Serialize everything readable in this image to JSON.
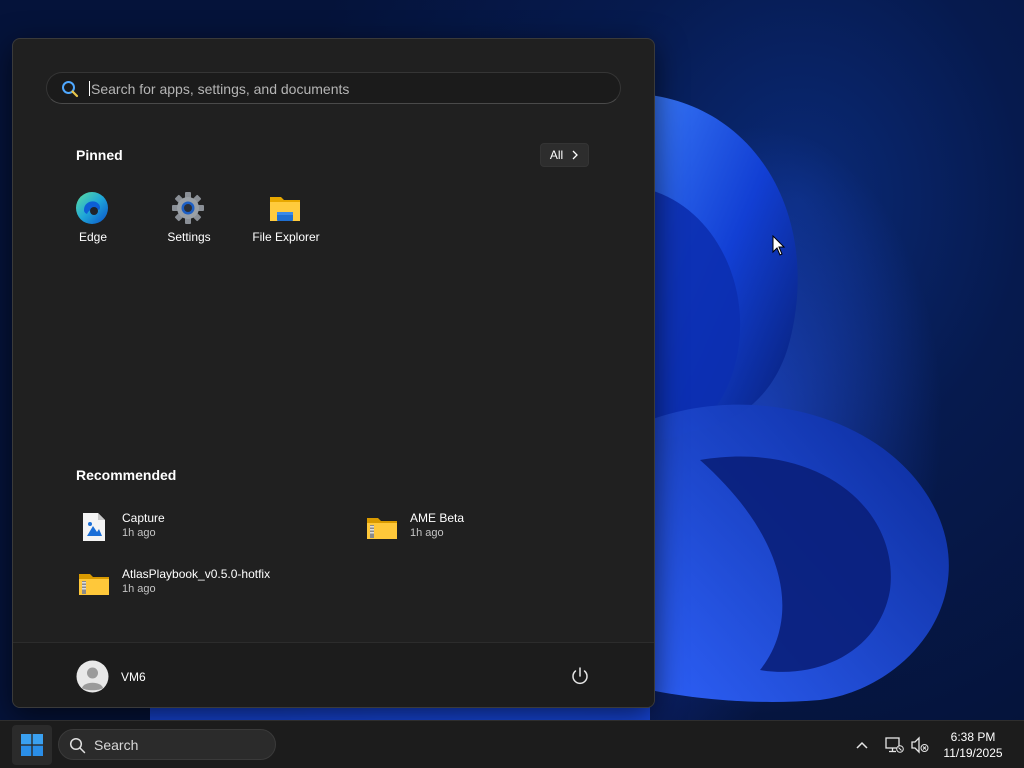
{
  "start_menu": {
    "search": {
      "placeholder": "Search for apps, settings, and documents"
    },
    "pinned": {
      "title": "Pinned",
      "all_label": "All",
      "apps": [
        {
          "label": "Edge",
          "icon": "edge-icon"
        },
        {
          "label": "Settings",
          "icon": "gear-icon"
        },
        {
          "label": "File Explorer",
          "icon": "folder-icon"
        }
      ]
    },
    "recommended": {
      "title": "Recommended",
      "items": [
        {
          "name": "Capture",
          "time": "1h ago",
          "icon": "image-file-icon"
        },
        {
          "name": "AME Beta",
          "time": "1h ago",
          "icon": "zip-folder-icon"
        },
        {
          "name": "AtlasPlaybook_v0.5.0-hotfix",
          "time": "1h ago",
          "icon": "zip-folder-icon"
        }
      ]
    },
    "user": {
      "name": "VM6"
    }
  },
  "taskbar": {
    "search_label": "Search",
    "clock": {
      "time": "6:38 PM",
      "date": "11/19/2025"
    }
  },
  "colors": {
    "menu_bg": "#202020",
    "taskbar_bg": "#1c1c1c",
    "accent": "#0078d4"
  }
}
